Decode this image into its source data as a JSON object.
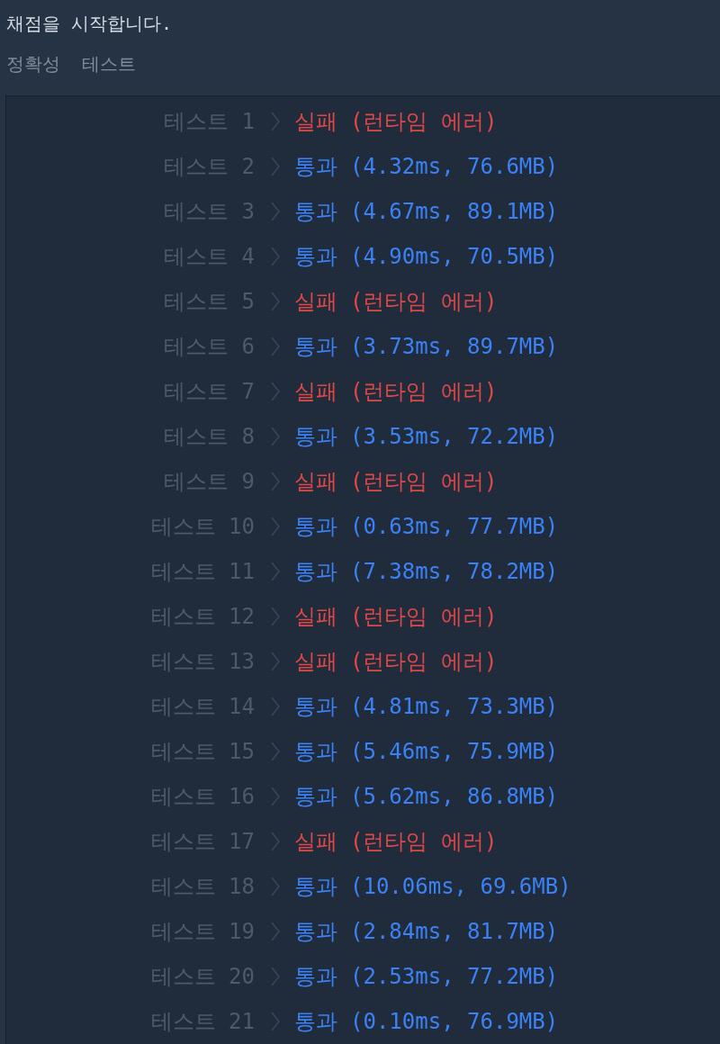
{
  "header": {
    "message": "채점을 시작합니다.",
    "section_title": "정확성 테스트"
  },
  "results": [
    {
      "label": "테스트 1",
      "kind": "fail",
      "result": "실패",
      "detail": "(런타임 에러)"
    },
    {
      "label": "테스트 2",
      "kind": "pass",
      "result": "통과",
      "detail": "(4.32ms, 76.6MB)"
    },
    {
      "label": "테스트 3",
      "kind": "pass",
      "result": "통과",
      "detail": "(4.67ms, 89.1MB)"
    },
    {
      "label": "테스트 4",
      "kind": "pass",
      "result": "통과",
      "detail": "(4.90ms, 70.5MB)"
    },
    {
      "label": "테스트 5",
      "kind": "fail",
      "result": "실패",
      "detail": "(런타임 에러)"
    },
    {
      "label": "테스트 6",
      "kind": "pass",
      "result": "통과",
      "detail": "(3.73ms, 89.7MB)"
    },
    {
      "label": "테스트 7",
      "kind": "fail",
      "result": "실패",
      "detail": "(런타임 에러)"
    },
    {
      "label": "테스트 8",
      "kind": "pass",
      "result": "통과",
      "detail": "(3.53ms, 72.2MB)"
    },
    {
      "label": "테스트 9",
      "kind": "fail",
      "result": "실패",
      "detail": "(런타임 에러)"
    },
    {
      "label": "테스트 10",
      "kind": "pass",
      "result": "통과",
      "detail": "(0.63ms, 77.7MB)"
    },
    {
      "label": "테스트 11",
      "kind": "pass",
      "result": "통과",
      "detail": "(7.38ms, 78.2MB)"
    },
    {
      "label": "테스트 12",
      "kind": "fail",
      "result": "실패",
      "detail": "(런타임 에러)"
    },
    {
      "label": "테스트 13",
      "kind": "fail",
      "result": "실패",
      "detail": "(런타임 에러)"
    },
    {
      "label": "테스트 14",
      "kind": "pass",
      "result": "통과",
      "detail": "(4.81ms, 73.3MB)"
    },
    {
      "label": "테스트 15",
      "kind": "pass",
      "result": "통과",
      "detail": "(5.46ms, 75.9MB)"
    },
    {
      "label": "테스트 16",
      "kind": "pass",
      "result": "통과",
      "detail": "(5.62ms, 86.8MB)"
    },
    {
      "label": "테스트 17",
      "kind": "fail",
      "result": "실패",
      "detail": "(런타임 에러)"
    },
    {
      "label": "테스트 18",
      "kind": "pass",
      "result": "통과",
      "detail": "(10.06ms, 69.6MB)"
    },
    {
      "label": "테스트 19",
      "kind": "pass",
      "result": "통과",
      "detail": "(2.84ms, 81.7MB)"
    },
    {
      "label": "테스트 20",
      "kind": "pass",
      "result": "통과",
      "detail": "(2.53ms, 77.2MB)"
    },
    {
      "label": "테스트 21",
      "kind": "pass",
      "result": "통과",
      "detail": "(0.10ms, 76.9MB)"
    }
  ]
}
